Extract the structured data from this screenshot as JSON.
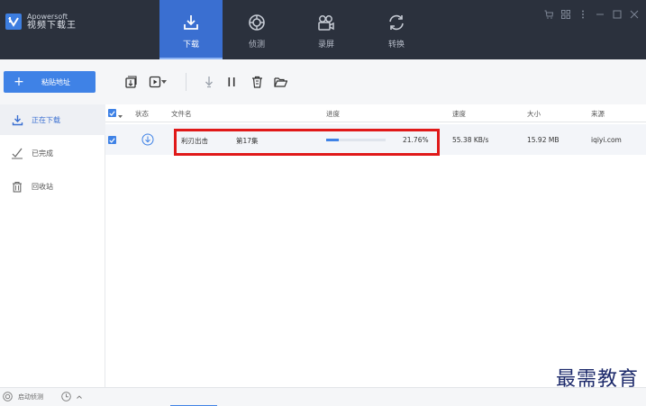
{
  "app": {
    "brand": "Apowersoft",
    "name": "视频下载王"
  },
  "nav": {
    "tabs": [
      {
        "label": "下载",
        "icon": "download-icon",
        "active": true
      },
      {
        "label": "侦测",
        "icon": "detect-icon",
        "active": false
      },
      {
        "label": "录屏",
        "icon": "screen-record-icon",
        "active": false
      },
      {
        "label": "转换",
        "icon": "convert-icon",
        "active": false
      }
    ]
  },
  "window_controls": [
    "cart-icon",
    "grid-icon",
    "menu-icon",
    "minimize-icon",
    "maximize-icon",
    "close-icon"
  ],
  "toolbar": {
    "paste_button": {
      "icon": "+",
      "label": "粘贴地址"
    },
    "icons": [
      "add-task-icon",
      "video-play-icon",
      "download-arrow-icon",
      "pause-icon",
      "delete-icon",
      "open-folder-icon"
    ]
  },
  "sidebar": {
    "items": [
      {
        "label": "正在下载",
        "icon": "download-icon",
        "active": true
      },
      {
        "label": "已完成",
        "icon": "completed-icon",
        "active": false
      },
      {
        "label": "回收站",
        "icon": "trash-icon",
        "active": false
      }
    ]
  },
  "table": {
    "columns": {
      "status": "状态",
      "filename": "文件名",
      "progress": "进度",
      "speed": "速度",
      "size": "大小",
      "source": "来源"
    },
    "rows": [
      {
        "checked": true,
        "status_icon": "downloading-icon",
        "title": "利刃出击",
        "episode": "第17集",
        "progress_text": "21.76%",
        "progress_value": 0.2176,
        "speed": "55.38 KB/s",
        "size": "15.92 MB",
        "source": "iqiyi.com"
      }
    ]
  },
  "statusbar": {
    "detect_label": "启动侦测",
    "schedule_icon": "clock-icon"
  },
  "watermark": "最需教育",
  "colors": {
    "header_bg": "#2b313d",
    "accent": "#3f82e6",
    "active_tab": "#3a6fd1",
    "highlight_border": "#e01919"
  }
}
